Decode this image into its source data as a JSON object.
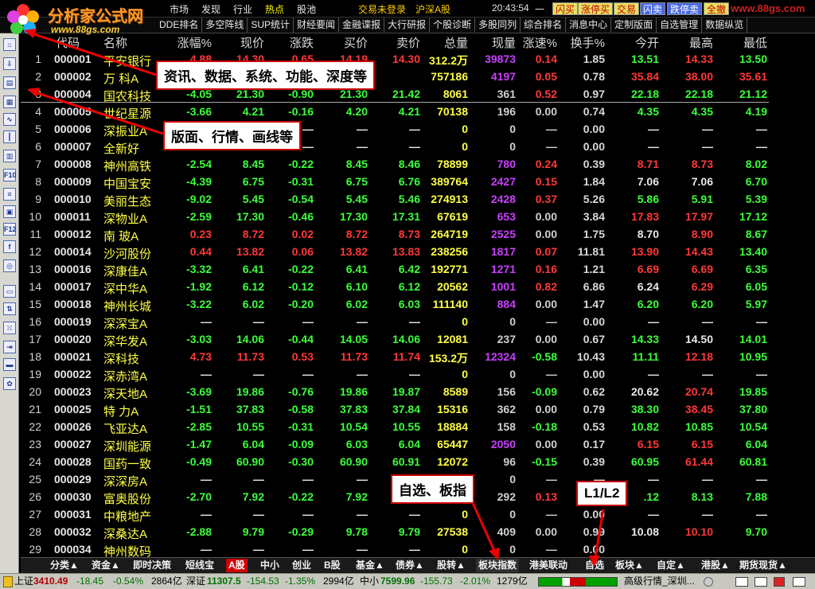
{
  "logo": {
    "title": "分析家公式网",
    "url": "www.88gs.com"
  },
  "menu": [
    "市场",
    "发现",
    "行业",
    "热点",
    "股池"
  ],
  "menu_hot_index": 3,
  "status": {
    "trade": "交易未登录",
    "market": "沪深A股",
    "time": "20:43:54",
    "dash": "一"
  },
  "top_buttons": [
    "闪买",
    "涨停买",
    "交易",
    "闪卖",
    "跌停卖",
    "全撤"
  ],
  "watermark": "www.88gs.com",
  "toolbar2": [
    "DDE排名",
    "多空阵线",
    "SUP统计",
    "财经要闻",
    "金融谍报",
    "大行研报",
    "个股诊断",
    "多股同列",
    "综合排名",
    "消息中心",
    "定制版面",
    "自选管理",
    "数据纵览"
  ],
  "headers": [
    "代码",
    "名称",
    "涨幅%",
    "现价",
    "涨跌",
    "买价",
    "卖价",
    "总量",
    "现量",
    "涨速%",
    "换手%",
    "今开",
    "最高",
    "最低"
  ],
  "rows": [
    {
      "i": "1",
      "code": "000001",
      "name": "平安银行",
      "pct": "4.88",
      "price": "14.30",
      "chg": "0.65",
      "bid": "14.19",
      "ask": "14.30",
      "vol": "312.2万",
      "cur": "39873",
      "spd": "0.14",
      "turn": "1.85",
      "open": "13.51",
      "high": "14.33",
      "low": "13.50",
      "d": "up",
      "o": "dn",
      "h": "up",
      "l": "dn"
    },
    {
      "i": "2",
      "code": "000002",
      "name": "万 科A",
      "pct": "",
      "price": "",
      "chg": "",
      "bid": "",
      "ask": "",
      "vol": "757186",
      "cur": "4197",
      "spd": "0.05",
      "turn": "0.78",
      "open": "35.84",
      "high": "38.00",
      "low": "35.61",
      "d": "up",
      "o": "up",
      "h": "up",
      "l": "up"
    },
    {
      "i": "3",
      "code": "000004",
      "name": "国农科技",
      "pct": "-4.05",
      "price": "21.30",
      "chg": "-0.90",
      "bid": "21.30",
      "ask": "21.42",
      "vol": "8061",
      "cur": "361",
      "spd": "0.52",
      "turn": "0.97",
      "open": "22.18",
      "high": "22.18",
      "low": "21.12",
      "d": "dn",
      "o": "dn",
      "h": "dn",
      "l": "dn"
    },
    {
      "i": "4",
      "code": "000005",
      "name": "世纪星源",
      "pct": "-3.66",
      "price": "4.21",
      "chg": "-0.16",
      "bid": "4.20",
      "ask": "4.21",
      "vol": "70138",
      "cur": "196",
      "spd": "0.00",
      "turn": "0.74",
      "open": "4.35",
      "high": "4.35",
      "low": "4.19",
      "d": "dn",
      "o": "dn",
      "h": "dn",
      "l": "dn"
    },
    {
      "i": "5",
      "code": "000006",
      "name": "深振业A",
      "pct": "—",
      "price": "—",
      "chg": "—",
      "bid": "—",
      "ask": "—",
      "vol": "0",
      "cur": "0",
      "spd": "—",
      "turn": "0.00",
      "open": "—",
      "high": "—",
      "low": "—",
      "d": "eq",
      "o": "eq",
      "h": "eq",
      "l": "eq"
    },
    {
      "i": "6",
      "code": "000007",
      "name": "全新好",
      "pct": "—",
      "price": "—",
      "chg": "—",
      "bid": "—",
      "ask": "—",
      "vol": "0",
      "cur": "0",
      "spd": "—",
      "turn": "0.00",
      "open": "—",
      "high": "—",
      "low": "—",
      "d": "eq",
      "o": "eq",
      "h": "eq",
      "l": "eq"
    },
    {
      "i": "7",
      "code": "000008",
      "name": "神州高铁",
      "pct": "-2.54",
      "price": "8.45",
      "chg": "-0.22",
      "bid": "8.45",
      "ask": "8.46",
      "vol": "78899",
      "cur": "780",
      "spd": "0.24",
      "turn": "0.39",
      "open": "8.71",
      "high": "8.73",
      "low": "8.02",
      "d": "dn",
      "o": "up",
      "h": "up",
      "l": "dn"
    },
    {
      "i": "8",
      "code": "000009",
      "name": "中国宝安",
      "pct": "-4.39",
      "price": "6.75",
      "chg": "-0.31",
      "bid": "6.75",
      "ask": "6.76",
      "vol": "389764",
      "cur": "2427",
      "spd": "0.15",
      "turn": "1.84",
      "open": "7.06",
      "high": "7.06",
      "low": "6.70",
      "d": "dn",
      "o": "eq",
      "h": "eq",
      "l": "dn"
    },
    {
      "i": "9",
      "code": "000010",
      "name": "美丽生态",
      "pct": "-9.02",
      "price": "5.45",
      "chg": "-0.54",
      "bid": "5.45",
      "ask": "5.46",
      "vol": "274913",
      "cur": "2428",
      "spd": "0.37",
      "turn": "5.26",
      "open": "5.86",
      "high": "5.91",
      "low": "5.39",
      "d": "dn",
      "o": "dn",
      "h": "dn",
      "l": "dn"
    },
    {
      "i": "10",
      "code": "000011",
      "name": "深物业A",
      "pct": "-2.59",
      "price": "17.30",
      "chg": "-0.46",
      "bid": "17.30",
      "ask": "17.31",
      "vol": "67619",
      "cur": "653",
      "spd": "0.00",
      "turn": "3.84",
      "open": "17.83",
      "high": "17.97",
      "low": "17.12",
      "d": "dn",
      "o": "up",
      "h": "up",
      "l": "dn"
    },
    {
      "i": "11",
      "code": "000012",
      "name": "南 玻A",
      "pct": "0.23",
      "price": "8.72",
      "chg": "0.02",
      "bid": "8.72",
      "ask": "8.73",
      "vol": "264719",
      "cur": "2525",
      "spd": "0.00",
      "turn": "1.75",
      "open": "8.70",
      "high": "8.90",
      "low": "8.67",
      "d": "up",
      "o": "eq",
      "h": "up",
      "l": "dn"
    },
    {
      "i": "12",
      "code": "000014",
      "name": "沙河股份",
      "pct": "0.44",
      "price": "13.82",
      "chg": "0.06",
      "bid": "13.82",
      "ask": "13.83",
      "vol": "238256",
      "cur": "1817",
      "spd": "0.07",
      "turn": "11.81",
      "open": "13.90",
      "high": "14.43",
      "low": "13.40",
      "d": "up",
      "o": "up",
      "h": "up",
      "l": "dn"
    },
    {
      "i": "13",
      "code": "000016",
      "name": "深康佳A",
      "pct": "-3.32",
      "price": "6.41",
      "chg": "-0.22",
      "bid": "6.41",
      "ask": "6.42",
      "vol": "192771",
      "cur": "1271",
      "spd": "0.16",
      "turn": "1.21",
      "open": "6.69",
      "high": "6.69",
      "low": "6.35",
      "d": "dn",
      "o": "up",
      "h": "up",
      "l": "dn"
    },
    {
      "i": "14",
      "code": "000017",
      "name": "深中华A",
      "pct": "-1.92",
      "price": "6.12",
      "chg": "-0.12",
      "bid": "6.10",
      "ask": "6.12",
      "vol": "20562",
      "cur": "1001",
      "spd": "0.82",
      "turn": "6.86",
      "open": "6.24",
      "high": "6.29",
      "low": "6.05",
      "d": "dn",
      "o": "eq",
      "h": "up",
      "l": "dn"
    },
    {
      "i": "15",
      "code": "000018",
      "name": "神州长城",
      "pct": "-3.22",
      "price": "6.02",
      "chg": "-0.20",
      "bid": "6.02",
      "ask": "6.03",
      "vol": "111140",
      "cur": "884",
      "spd": "0.00",
      "turn": "1.47",
      "open": "6.20",
      "high": "6.20",
      "low": "5.97",
      "d": "dn",
      "o": "dn",
      "h": "dn",
      "l": "dn"
    },
    {
      "i": "16",
      "code": "000019",
      "name": "深深宝A",
      "pct": "—",
      "price": "—",
      "chg": "—",
      "bid": "—",
      "ask": "—",
      "vol": "0",
      "cur": "0",
      "spd": "—",
      "turn": "0.00",
      "open": "—",
      "high": "—",
      "low": "—",
      "d": "eq",
      "o": "eq",
      "h": "eq",
      "l": "eq"
    },
    {
      "i": "17",
      "code": "000020",
      "name": "深华发A",
      "pct": "-3.03",
      "price": "14.06",
      "chg": "-0.44",
      "bid": "14.05",
      "ask": "14.06",
      "vol": "12081",
      "cur": "237",
      "spd": "0.00",
      "turn": "0.67",
      "open": "14.33",
      "high": "14.50",
      "low": "14.01",
      "d": "dn",
      "o": "dn",
      "h": "eq",
      "l": "dn"
    },
    {
      "i": "18",
      "code": "000021",
      "name": "深科技",
      "pct": "4.73",
      "price": "11.73",
      "chg": "0.53",
      "bid": "11.73",
      "ask": "11.74",
      "vol": "153.2万",
      "cur": "12324",
      "spd": "-0.58",
      "turn": "10.43",
      "open": "11.11",
      "high": "12.18",
      "low": "10.95",
      "d": "up",
      "o": "dn",
      "h": "up",
      "l": "dn"
    },
    {
      "i": "19",
      "code": "000022",
      "name": "深赤湾A",
      "pct": "—",
      "price": "—",
      "chg": "—",
      "bid": "—",
      "ask": "—",
      "vol": "0",
      "cur": "0",
      "spd": "—",
      "turn": "0.00",
      "open": "—",
      "high": "—",
      "low": "—",
      "d": "eq",
      "o": "eq",
      "h": "eq",
      "l": "eq"
    },
    {
      "i": "20",
      "code": "000023",
      "name": "深天地A",
      "pct": "-3.69",
      "price": "19.86",
      "chg": "-0.76",
      "bid": "19.86",
      "ask": "19.87",
      "vol": "8589",
      "cur": "156",
      "spd": "-0.09",
      "turn": "0.62",
      "open": "20.62",
      "high": "20.74",
      "low": "19.85",
      "d": "dn",
      "o": "eq",
      "h": "up",
      "l": "dn"
    },
    {
      "i": "21",
      "code": "000025",
      "name": "特 力A",
      "pct": "-1.51",
      "price": "37.83",
      "chg": "-0.58",
      "bid": "37.83",
      "ask": "37.84",
      "vol": "15316",
      "cur": "362",
      "spd": "0.00",
      "turn": "0.79",
      "open": "38.30",
      "high": "38.45",
      "low": "37.80",
      "d": "dn",
      "o": "dn",
      "h": "up",
      "l": "dn"
    },
    {
      "i": "22",
      "code": "000026",
      "name": "飞亚达A",
      "pct": "-2.85",
      "price": "10.55",
      "chg": "-0.31",
      "bid": "10.54",
      "ask": "10.55",
      "vol": "18884",
      "cur": "158",
      "spd": "-0.18",
      "turn": "0.53",
      "open": "10.82",
      "high": "10.85",
      "low": "10.54",
      "d": "dn",
      "o": "dn",
      "h": "dn",
      "l": "dn"
    },
    {
      "i": "23",
      "code": "000027",
      "name": "深圳能源",
      "pct": "-1.47",
      "price": "6.04",
      "chg": "-0.09",
      "bid": "6.03",
      "ask": "6.04",
      "vol": "65447",
      "cur": "2050",
      "spd": "0.00",
      "turn": "0.17",
      "open": "6.15",
      "high": "6.15",
      "low": "6.04",
      "d": "dn",
      "o": "up",
      "h": "up",
      "l": "dn"
    },
    {
      "i": "24",
      "code": "000028",
      "name": "国药一致",
      "pct": "-0.49",
      "price": "60.90",
      "chg": "-0.30",
      "bid": "60.90",
      "ask": "60.91",
      "vol": "12072",
      "cur": "96",
      "spd": "-0.15",
      "turn": "0.39",
      "open": "60.95",
      "high": "61.44",
      "low": "60.81",
      "d": "dn",
      "o": "dn",
      "h": "up",
      "l": "dn"
    },
    {
      "i": "25",
      "code": "000029",
      "name": "深深房A",
      "pct": "—",
      "price": "—",
      "chg": "—",
      "bid": "—",
      "ask": "—",
      "vol": "0",
      "cur": "0",
      "spd": "—",
      "turn": "—",
      "open": "—",
      "high": "—",
      "low": "—",
      "d": "eq",
      "o": "eq",
      "h": "eq",
      "l": "eq"
    },
    {
      "i": "26",
      "code": "000030",
      "name": "富奥股份",
      "pct": "-2.70",
      "price": "7.92",
      "chg": "-0.22",
      "bid": "7.92",
      "ask": "",
      "vol": "",
      "cur": "292",
      "spd": "0.13",
      "turn": "",
      "open": ".12",
      "high": "8.13",
      "low": "7.88",
      "d": "dn",
      "o": "dn",
      "h": "dn",
      "l": "dn"
    },
    {
      "i": "27",
      "code": "000031",
      "name": "中粮地产",
      "pct": "—",
      "price": "—",
      "chg": "—",
      "bid": "—",
      "ask": "—",
      "vol": "0",
      "cur": "0",
      "spd": "—",
      "turn": "0.00",
      "open": "—",
      "high": "—",
      "low": "—",
      "d": "eq",
      "o": "eq",
      "h": "eq",
      "l": "eq"
    },
    {
      "i": "28",
      "code": "000032",
      "name": "深桑达A",
      "pct": "-2.88",
      "price": "9.79",
      "chg": "-0.29",
      "bid": "9.78",
      "ask": "9.79",
      "vol": "27538",
      "cur": "409",
      "spd": "0.00",
      "turn": "0.99",
      "open": "10.08",
      "high": "10.10",
      "low": "9.70",
      "d": "dn",
      "o": "eq",
      "h": "up",
      "l": "dn"
    },
    {
      "i": "29",
      "code": "000034",
      "name": "神州数码",
      "pct": "—",
      "price": "—",
      "chg": "—",
      "bid": "—",
      "ask": "—",
      "vol": "0",
      "cur": "0",
      "spd": "—",
      "turn": "0.00",
      "open": "",
      "high": "",
      "low": "",
      "d": "eq",
      "o": "eq",
      "h": "eq",
      "l": "eq"
    }
  ],
  "notes": {
    "n1": "资讯、数据、系统、功能、深度等",
    "n2": "版面、行情、画线等",
    "n3": "自选、板指",
    "n4": "L1/L2"
  },
  "bottom_tabs": [
    "分类▲",
    "资金▲",
    "即时决策",
    "短线宝",
    "A股",
    "中小",
    "创业",
    "B股",
    "基金▲",
    "债券▲",
    "股转▲",
    "板块指数",
    "港美联动",
    "自选",
    "板块▲",
    "自定▲",
    "港股▲",
    "期货现货▲"
  ],
  "statusbar": {
    "sh_label": "上证",
    "sh_idx": "3410.49",
    "sh_chg": "-18.45",
    "sh_pct": "-0.54%",
    "sh_amt": "2864亿",
    "sz_label": "深证",
    "sz_idx": "11307.5",
    "sz_chg": "-154.53",
    "sz_pct": "-1.35%",
    "sz_amt": "2994亿",
    "zx_label": "中小",
    "zx_idx": "7599.96",
    "zx_chg": "-155.73",
    "zx_pct": "-2.01%",
    "zx_amt": "1279亿",
    "hq": "高级行情_深圳..."
  },
  "colors": {
    "up": "#ff3838",
    "down": "#3cff3c",
    "name": "#ffff44",
    "volume_highlight": "#c840ff"
  }
}
